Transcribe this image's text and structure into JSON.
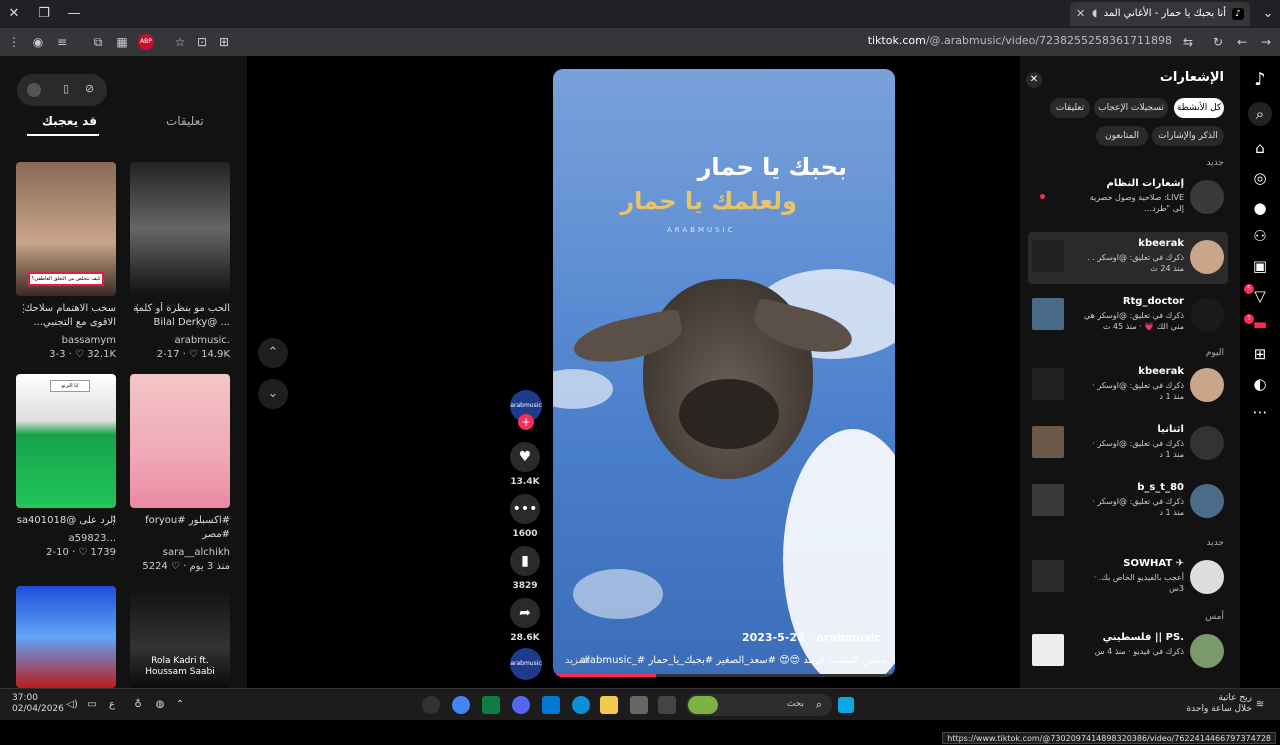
{
  "browser": {
    "tab_title": "أنا بحبك يا حمار - الأغاني المد",
    "url_domain": "tiktok.com",
    "url_path": "/@.arabmusic/video/7238255258361711898",
    "status_url": "https://www.tiktok.com/@7302097414898320386/video/7622414466797374728"
  },
  "left": {
    "tabs": [
      "تعليقات",
      "قد يعجبك"
    ],
    "active_tab": "قد يعجبك",
    "videos": [
      {
        "overlay": "كيف تتخلص من التعلق العاطفي؟",
        "caption": "سحب الاهتمام سلاحك الاقوى مع التجنبي...",
        "author": "bassamym",
        "likes": "32.1K",
        "date": "3-3"
      },
      {
        "overlay": "",
        "caption": "الحب مو بنظرة أو كلمة ... @Bilal Derky",
        "author": "arabmusic.",
        "likes": "14.9K",
        "date": "2-17"
      },
      {
        "overlay": "انا البرتو",
        "caption": "الرد على @sa401018",
        "author": "a59823...",
        "likes": "1739",
        "date": "2-10"
      },
      {
        "overlay": "",
        "caption": "#اكسبلور #foryou #مصر",
        "author": "sara__alchikh",
        "likes": "5224",
        "date": "منذ 3 يوم"
      },
      {
        "overlay": "",
        "caption": "",
        "author": "",
        "likes": "",
        "date": ""
      },
      {
        "overlay": "Rola Kadri ft. Houssam Saabi",
        "caption": "",
        "author": "",
        "likes": "",
        "date": ""
      }
    ]
  },
  "video": {
    "line1": "بحبك يا حمار",
    "line2": "ولعلمك يا حمار",
    "brand": "ARABMUSIC",
    "author": "arabmusic.",
    "date": "2023-5-28",
    "description": "منشن للبيست فريند 😍😍 #سعد_الصغير #بحبك_يا_حمار #_arabmusic",
    "more": "المزيد",
    "progress": 0.3,
    "avatar_label": "arabmusic",
    "likes": "13.4K",
    "comments": "1600",
    "saves": "3829",
    "shares": "28.6K"
  },
  "notifications": {
    "title": "الإشعارات",
    "chips": [
      "كل الأنشطة",
      "تسجيلات الإعجاب",
      "تعليقات",
      "الذكر والإشارات",
      "المتابعون"
    ],
    "active_chip": "كل الأنشطة",
    "sections": [
      "جديد",
      "اليوم",
      "جديد",
      "أمس"
    ],
    "items": [
      {
        "name": "إشعارات النظام",
        "text": "LIVE: صلاحية وصول حصرية إلى \"طرد...",
        "unread": true
      },
      {
        "name": "kbeerak",
        "text": "ذكرك في تعليق: @اوسكر . . منذ 24 ث"
      },
      {
        "name": "Rtg_doctor",
        "text": "ذكرك في تعليق: @اوسكر هي مني الك 💗 · منذ 45 ث"
      },
      {
        "name": "kbeerak",
        "text": "ذكرك في تعليق: @اوسكر · منذ 1 د"
      },
      {
        "name": "اثنانيا",
        "text": "ذكرك في تعليق: @اوسكر · منذ 1 د"
      },
      {
        "name": "b_s_t_80",
        "text": "ذكرك في تعليق: @اوسكر · منذ 1 د"
      },
      {
        "name": "SOWHAT ✈",
        "text": "أعجب بالفيديو الخاص بك. · 3س"
      },
      {
        "name": "فلسطيني || PS.",
        "text": "ذكرك في فيديو · منذ 4 س"
      }
    ]
  },
  "rail_badges": {
    "inbox": "5",
    "messages": "1"
  },
  "taskbar": {
    "time": "37:00",
    "date": "02/04/2026",
    "lang": "ع",
    "search_placeholder": "بحث",
    "weather_line1": "ريح عاتية",
    "weather_line2": "خلال ساعة واحدة"
  },
  "colors": {
    "accent": "#fe2c55",
    "bg": "#121212"
  }
}
